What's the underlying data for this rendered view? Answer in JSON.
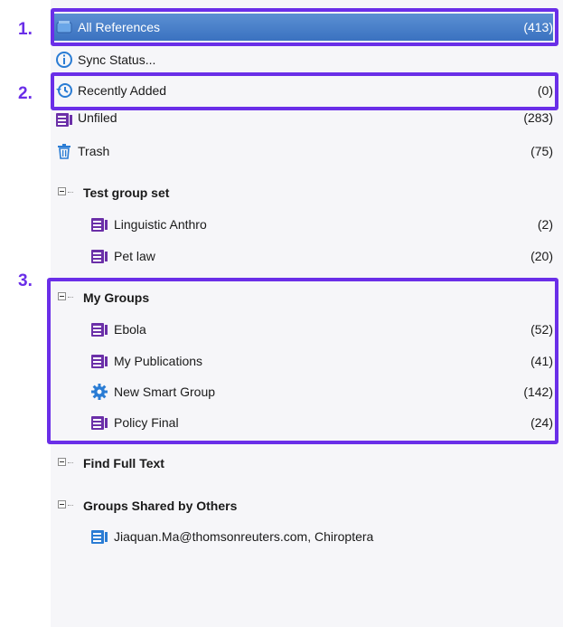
{
  "annotations": [
    "1.",
    "2.",
    "3."
  ],
  "items": {
    "all_references": {
      "label": "All References",
      "count": "(413)"
    },
    "sync_status": {
      "label": "Sync Status..."
    },
    "recently_added": {
      "label": "Recently Added",
      "count": "(0)"
    },
    "unfiled": {
      "label": "Unfiled",
      "count": "(283)"
    },
    "trash": {
      "label": "Trash",
      "count": "(75)"
    }
  },
  "groups": [
    {
      "title": "Test group set",
      "items": [
        {
          "label": "Linguistic Anthro",
          "count": "(2)"
        },
        {
          "label": "Pet law",
          "count": "(20)"
        }
      ]
    },
    {
      "title": "My Groups",
      "items": [
        {
          "label": "Ebola",
          "count": "(52)"
        },
        {
          "label": "My Publications",
          "count": "(41)"
        },
        {
          "label": "New Smart Group",
          "count": "(142)"
        },
        {
          "label": "Policy Final",
          "count": "(24)"
        }
      ]
    },
    {
      "title": "Find Full Text",
      "items": []
    },
    {
      "title": "Groups Shared by Others",
      "items": [
        {
          "label": "Jiaquan.Ma@thomsonreuters.com, Chiroptera"
        }
      ]
    }
  ],
  "colors": {
    "accent": "#6a2ee8",
    "selection": "#3a72c0",
    "group_icon": "#6b2fa8",
    "blue_icon": "#2a7cd4"
  }
}
